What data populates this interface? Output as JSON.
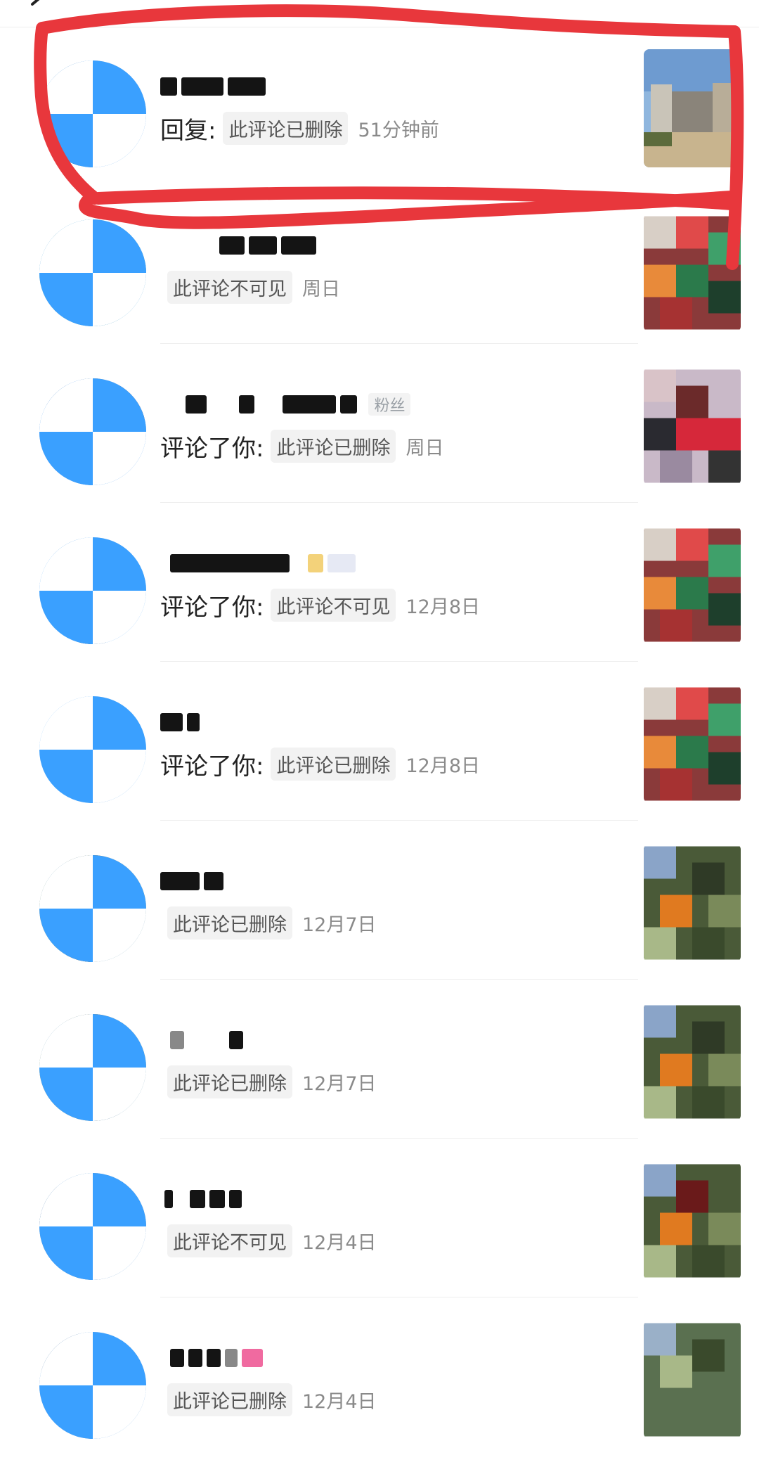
{
  "notifications": [
    {
      "action": "回复:",
      "chip": "此评论已删除",
      "time": "51分钟前"
    },
    {
      "action": "",
      "chip": "此评论不可见",
      "time": "周日"
    },
    {
      "action": "评论了你:",
      "chip": "此评论已删除",
      "time": "周日",
      "tag": "粉丝"
    },
    {
      "action": "评论了你:",
      "chip": "此评论不可见",
      "time": "12月8日"
    },
    {
      "action": "评论了你:",
      "chip": "此评论已删除",
      "time": "12月8日"
    },
    {
      "action": "",
      "chip": "此评论已删除",
      "time": "12月7日"
    },
    {
      "action": "",
      "chip": "此评论已删除",
      "time": "12月7日"
    },
    {
      "action": "",
      "chip": "此评论不可见",
      "time": "12月4日"
    },
    {
      "action": "",
      "chip": "此评论已删除",
      "time": "12月4日"
    }
  ],
  "colors": {
    "annotation": "#e8373c",
    "badge": "#3aa0ff",
    "chip_bg": "#f2f2f2",
    "time": "#8a8a8a"
  },
  "icons": {
    "back": "back-arrow-icon",
    "badge": "verified-v-icon"
  }
}
